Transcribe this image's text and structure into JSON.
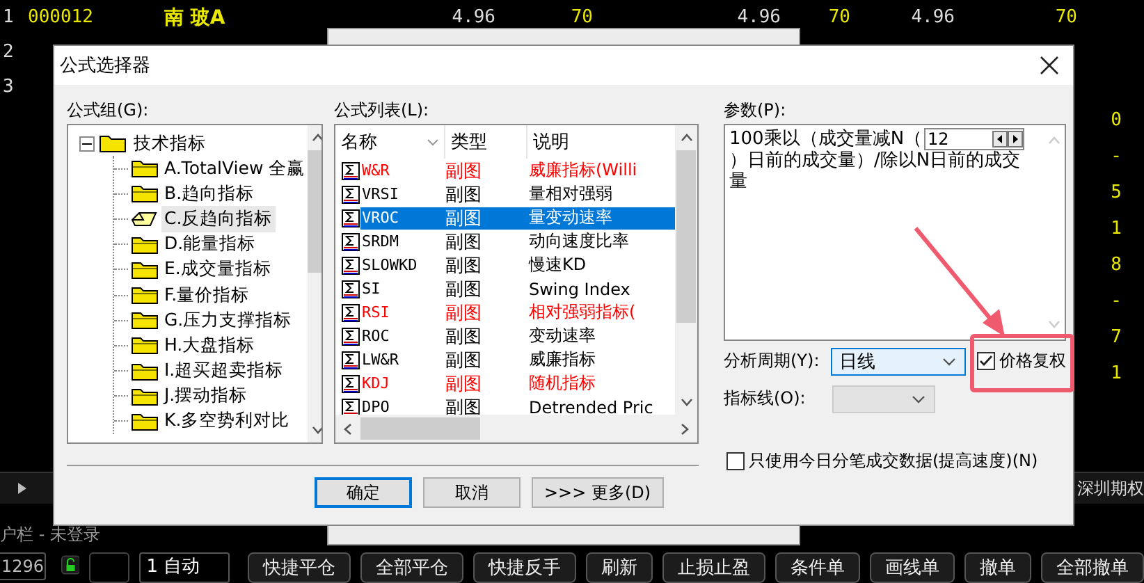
{
  "background": {
    "quote_rows": [
      {
        "index": "1",
        "code": "000012",
        "name": "南 玻A",
        "cells": [
          "4.96",
          "70",
          "4.96",
          "70",
          "4.96",
          "70"
        ]
      },
      {
        "index": "2"
      },
      {
        "index": "3"
      }
    ],
    "right_fragments": [
      "0",
      "-",
      "5",
      "1",
      "8",
      "-",
      "7",
      "1"
    ],
    "tab_bar": {
      "label": "深圳期权"
    },
    "status": "户栏 - 未登录",
    "order_bar": {
      "quantity": "1296",
      "mode": "1 自动",
      "buttons": [
        "快捷平仓",
        "全部平仓",
        "快捷反手",
        "刷新",
        "止损止盈",
        "条件单",
        "画线单",
        "撤单",
        "全部撤单"
      ]
    }
  },
  "dialog": {
    "title": "公式选择器",
    "groups": {
      "label": "公式组(G):",
      "tree": {
        "label": "技术指标",
        "expanded": true,
        "children": [
          {
            "label": "A.TotalView 全赢",
            "selected": false
          },
          {
            "label": "B.趋向指标",
            "selected": false
          },
          {
            "label": "C.反趋向指标",
            "selected": true
          },
          {
            "label": "D.能量指标",
            "selected": false
          },
          {
            "label": "E.成交量指标",
            "selected": false
          },
          {
            "label": "F.量价指标",
            "selected": false
          },
          {
            "label": "G.压力支撑指标",
            "selected": false
          },
          {
            "label": "H.大盘指标",
            "selected": false
          },
          {
            "label": "I.超买超卖指标",
            "selected": false
          },
          {
            "label": "J.摆动指标",
            "selected": false
          },
          {
            "label": "K.多空势利对比",
            "selected": false
          }
        ]
      }
    },
    "formulas": {
      "label": "公式列表(L):",
      "columns": [
        "名称",
        "类型",
        "说明"
      ],
      "rows": [
        {
          "name": "W&R",
          "type": "副图",
          "description": "威廉指标(Willi",
          "highlighted": true,
          "selected": false
        },
        {
          "name": "VRSI",
          "type": "副图",
          "description": "量相对强弱",
          "highlighted": false,
          "selected": false
        },
        {
          "name": "VROC",
          "type": "副图",
          "description": "量变动速率",
          "highlighted": false,
          "selected": true
        },
        {
          "name": "SRDM",
          "type": "副图",
          "description": "动向速度比率",
          "highlighted": false,
          "selected": false
        },
        {
          "name": "SLOWKD",
          "type": "副图",
          "description": "慢速KD",
          "highlighted": false,
          "selected": false
        },
        {
          "name": "SI",
          "type": "副图",
          "description": "Swing Index",
          "highlighted": false,
          "selected": false
        },
        {
          "name": "RSI",
          "type": "副图",
          "description": "相对强弱指标(",
          "highlighted": true,
          "selected": false
        },
        {
          "name": "ROC",
          "type": "副图",
          "description": "变动速率",
          "highlighted": false,
          "selected": false
        },
        {
          "name": "LW&R",
          "type": "副图",
          "description": "威廉指标",
          "highlighted": false,
          "selected": false
        },
        {
          "name": "KDJ",
          "type": "副图",
          "description": "随机指标",
          "highlighted": true,
          "selected": false
        },
        {
          "name": "DPO",
          "type": "副图",
          "description": "Detrended Pric",
          "highlighted": false,
          "selected": false
        }
      ]
    },
    "params": {
      "label": "参数(P):",
      "text_before": "100乘以（成交量减N（",
      "value": "12",
      "text_after": "）日前的成交量）/除以N日前的成交量"
    },
    "period": {
      "label": "分析周期(Y):",
      "value": "日线"
    },
    "price_adjust": {
      "label": "价格复权",
      "checked": true
    },
    "indicator_line": {
      "label": "指标线(O):",
      "disabled": true
    },
    "today_only": {
      "label": "只使用今日分笔成交数据(提高速度)(N)",
      "checked": false
    },
    "buttons": [
      {
        "label": "确定",
        "default": true
      },
      {
        "label": "取消",
        "default": false
      },
      {
        "label": ">>> 更多(D)",
        "default": false
      }
    ]
  }
}
